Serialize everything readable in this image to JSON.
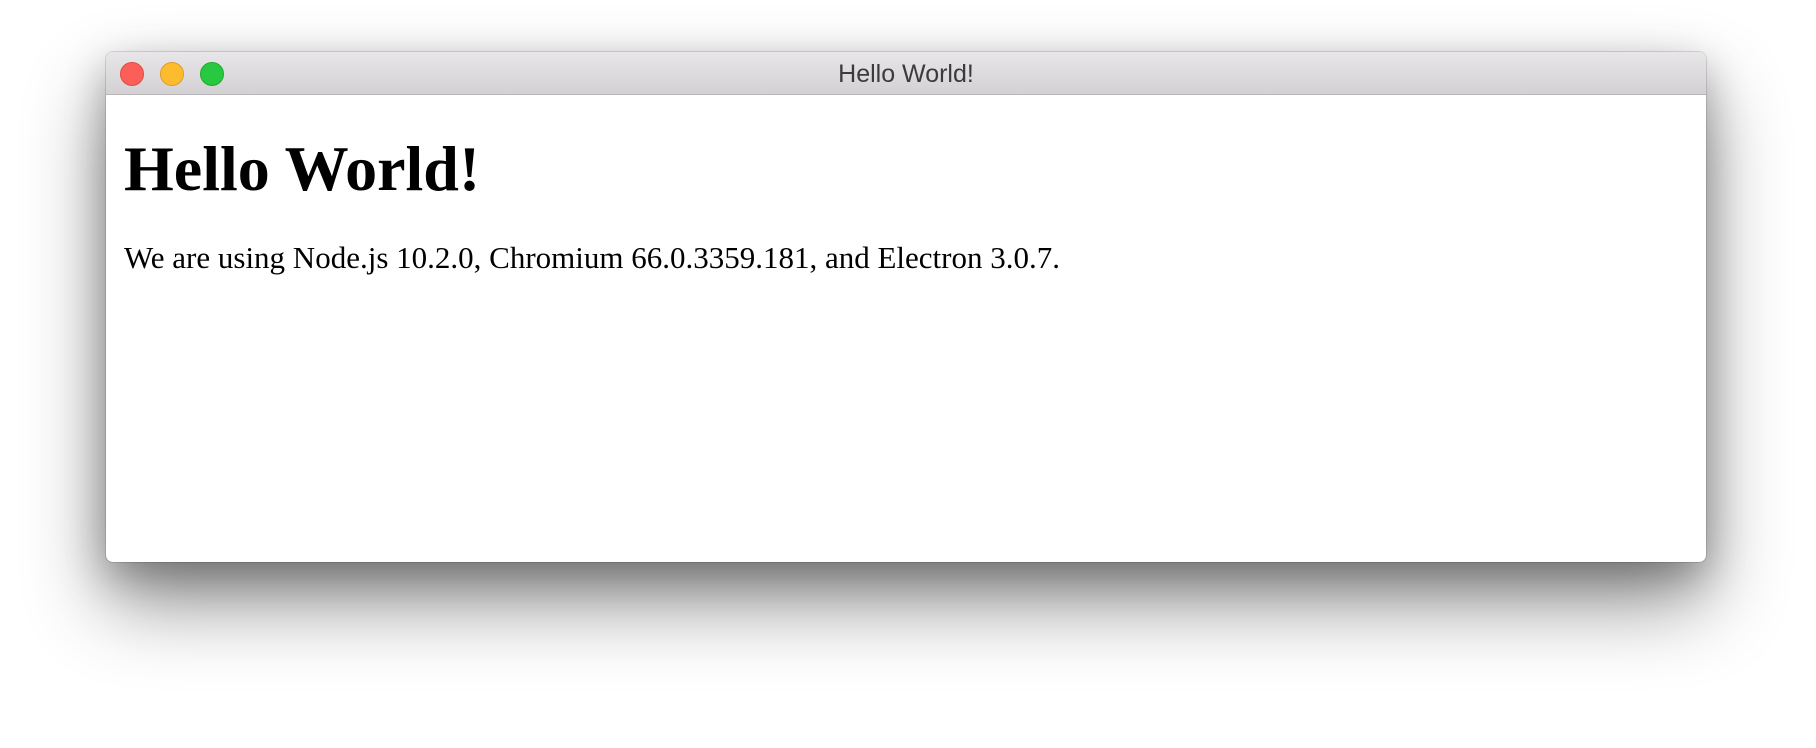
{
  "window": {
    "title": "Hello World!",
    "controls": {
      "close_color": "#fc5f57",
      "minimize_color": "#fdbc2e",
      "zoom_color": "#28c840"
    }
  },
  "content": {
    "heading": "Hello World!",
    "versions": {
      "prefix": "We are using Node.js ",
      "node": "10.2.0",
      "chromium_prefix": ", Chromium ",
      "chromium": "66.0.3359.181",
      "electron_prefix": ", and Electron ",
      "electron": "3.0.7",
      "suffix": "."
    }
  }
}
